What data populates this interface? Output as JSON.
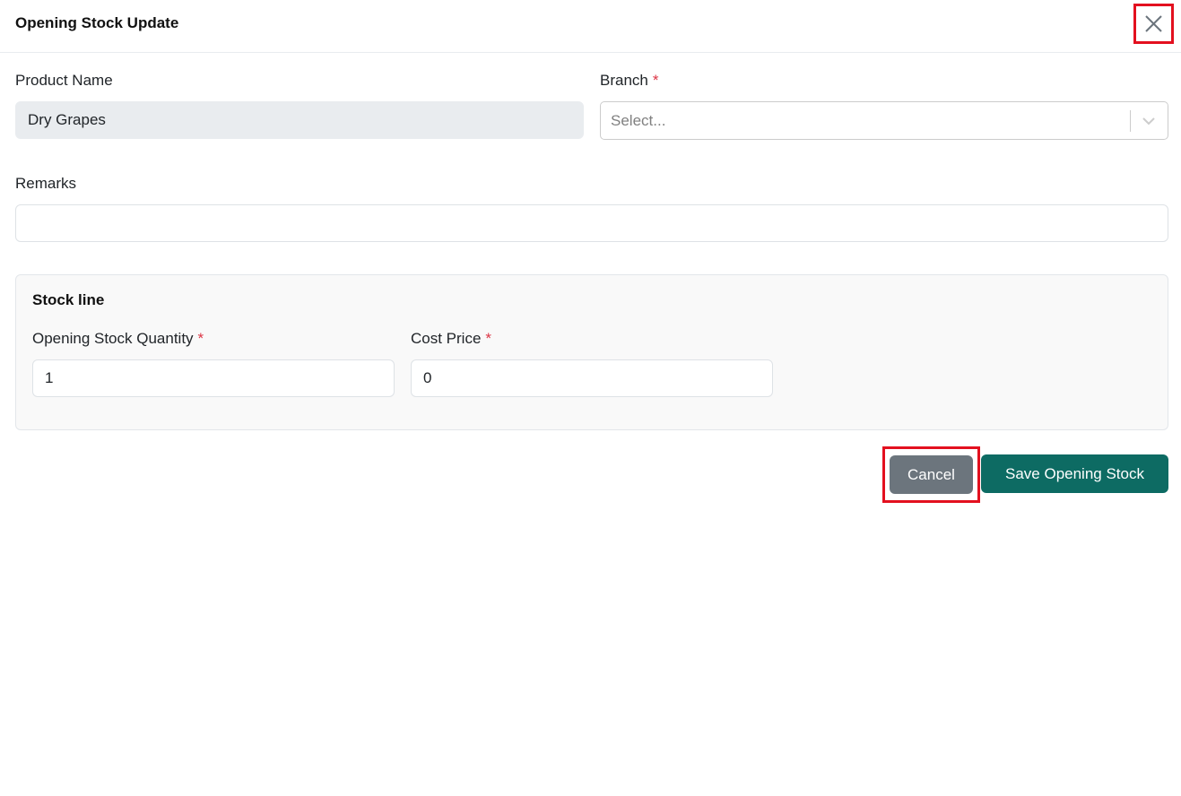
{
  "modal": {
    "title": "Opening Stock Update",
    "close_icon": "close-icon"
  },
  "form": {
    "product_name": {
      "label": "Product Name",
      "value": "Dry Grapes"
    },
    "branch": {
      "label": "Branch",
      "required_marker": "*",
      "placeholder": "Select...",
      "chevron_icon": "chevron-down-icon"
    },
    "remarks": {
      "label": "Remarks",
      "value": ""
    }
  },
  "stock_line": {
    "title": "Stock line",
    "quantity": {
      "label": "Opening Stock Quantity",
      "required_marker": "*",
      "value": "1"
    },
    "cost_price": {
      "label": "Cost Price",
      "required_marker": "*",
      "value": "0"
    }
  },
  "actions": {
    "cancel_label": "Cancel",
    "save_label": "Save Opening Stock"
  },
  "colors": {
    "required": "#dc3545",
    "cancel_bg": "#6c757d",
    "save_bg": "#0d6b63",
    "highlight_border": "#e3101f"
  }
}
